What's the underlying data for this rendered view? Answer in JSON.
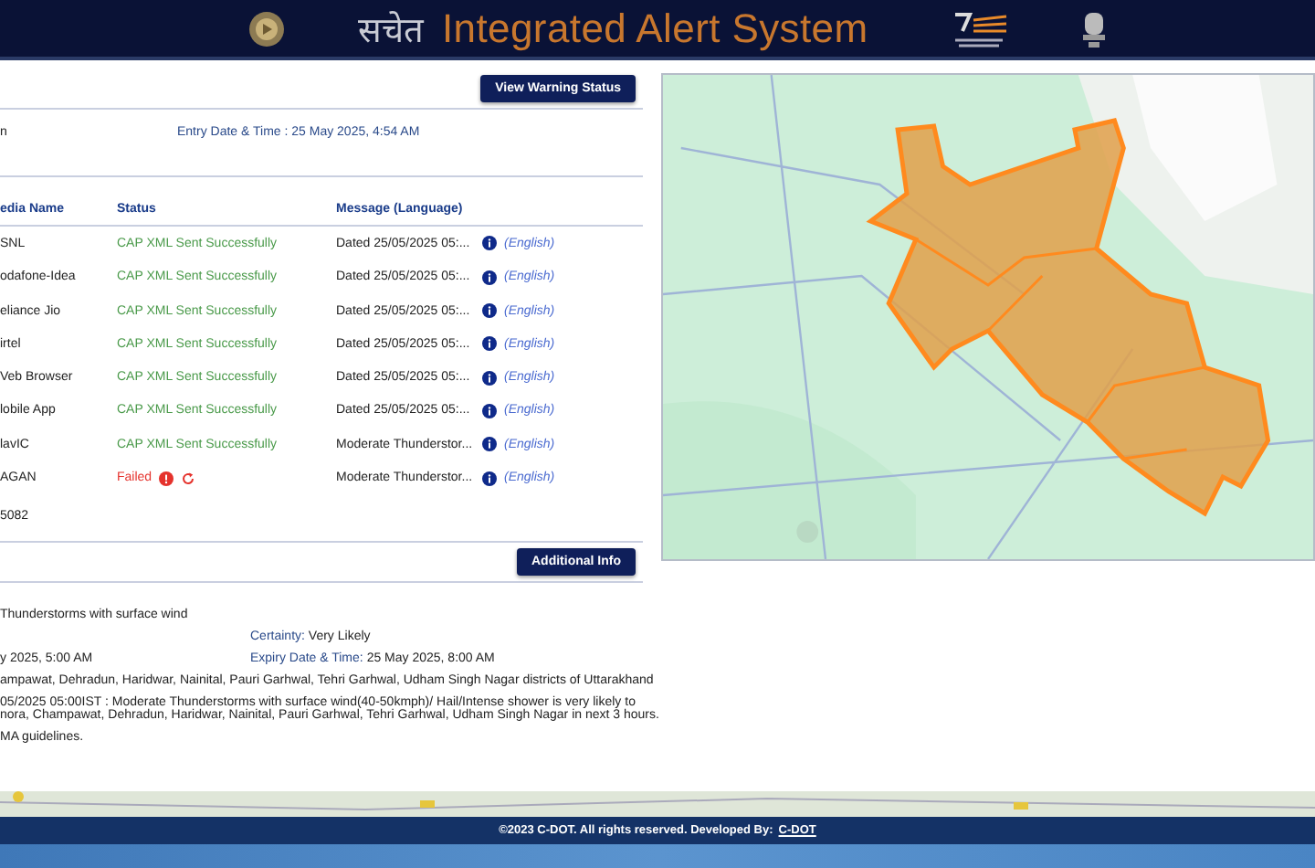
{
  "header": {
    "logo_text": "सचेत",
    "title": "Integrated Alert System"
  },
  "toolbar": {
    "button": "View Warning Status"
  },
  "summary": {
    "label": "n",
    "entry": "Entry Date & Time : 25 May 2025, 4:54 AM"
  },
  "table": {
    "columns": [
      "edia Name",
      "Status",
      "Message (Language)"
    ],
    "rows": [
      {
        "name": "SNL",
        "status": "CAP XML Sent Successfully",
        "kind": "success",
        "message": "Dated 25/05/2025 05:...",
        "language": "(English)"
      },
      {
        "name": "odafone-Idea",
        "status": "CAP XML Sent Successfully",
        "kind": "success",
        "message": "Dated 25/05/2025 05:...",
        "language": "(English)"
      },
      {
        "name": "eliance Jio",
        "status": "CAP XML Sent Successfully",
        "kind": "success",
        "message": "Dated 25/05/2025 05:...",
        "language": "(English)"
      },
      {
        "name": "irtel",
        "status": "CAP XML Sent Successfully",
        "kind": "success",
        "message": "Dated 25/05/2025 05:...",
        "language": "(English)"
      },
      {
        "name": "Veb Browser",
        "status": "CAP XML Sent Successfully",
        "kind": "success",
        "message": "Dated 25/05/2025 05:...",
        "language": "(English)"
      },
      {
        "name": "lobile App",
        "status": "CAP XML Sent Successfully",
        "kind": "success",
        "message": "Dated 25/05/2025 05:...",
        "language": "(English)"
      },
      {
        "name": "lavIC",
        "status": "CAP XML Sent Successfully",
        "kind": "success",
        "message": "Moderate Thunderstor...",
        "language": "(English)"
      },
      {
        "name": "AGAN",
        "status": "Failed",
        "kind": "failed",
        "message": "Moderate Thunderstor...",
        "language": "(English)"
      }
    ]
  },
  "alert_id": "5082",
  "info_button": "Additional Info",
  "details": {
    "headline": "Thunderstorms with surface wind",
    "certainty_label": "Certainty:",
    "certainty": "Very Likely",
    "effective": "y 2025, 5:00 AM",
    "expiry_label": "Expiry Date & Time:",
    "expiry": "25 May 2025, 8:00 AM",
    "area": "ampawat, Dehradun, Haridwar, Nainital, Pauri Garhwal, Tehri Garhwal, Udham Singh Nagar districts of Uttarakhand",
    "description": [
      "05/2025 05:00IST : Moderate Thunderstorms with surface wind(40-50kmph)/ Hail/Intense shower is very likely to",
      "nora, Champawat, Dehradun, Haridwar, Nainital, Pauri Garhwal, Tehri Garhwal, Udham Singh Nagar in next 3 hours."
    ],
    "instruction": "MA guidelines."
  },
  "footer": {
    "text": "©2023 C-DOT. All rights reserved. Developed By:",
    "link": "C-DOT"
  }
}
